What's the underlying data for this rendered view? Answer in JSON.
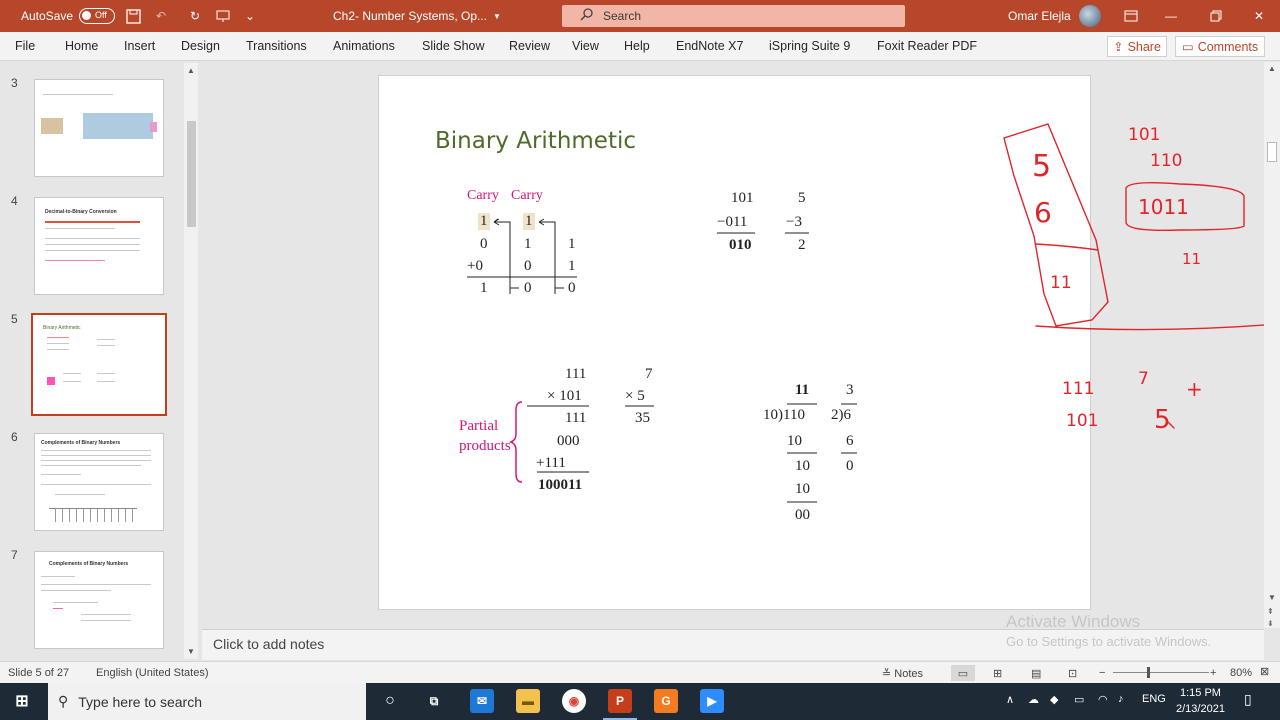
{
  "titlebar": {
    "autosave_label": "AutoSave",
    "autosave_state": "Off",
    "doc_title": "Ch2- Number Systems, Op...",
    "search_placeholder": "Search",
    "user_name": "Omar Elejla",
    "accent_color": "#b7472a"
  },
  "ribbon": {
    "tabs": [
      "File",
      "Home",
      "Insert",
      "Design",
      "Transitions",
      "Animations",
      "Slide Show",
      "Review",
      "View",
      "Help",
      "EndNote X7",
      "iSpring Suite 9",
      "Foxit Reader PDF"
    ],
    "share_label": "Share",
    "comments_label": "Comments"
  },
  "thumbnails": [
    {
      "number": "3",
      "title": ""
    },
    {
      "number": "4",
      "title": "Decimal-to-Binary Conversion"
    },
    {
      "number": "5",
      "title": "Binary Arithmetic"
    },
    {
      "number": "6",
      "title": "Complements of Binary Numbers"
    },
    {
      "number": "7",
      "title": "Complements of Binary Numbers"
    }
  ],
  "slide": {
    "title": "Binary Arithmetic",
    "addition": {
      "carry1": "Carry",
      "carry2": "Carry",
      "carry_vals": [
        "1",
        "1"
      ],
      "row1": [
        "0",
        "1",
        "1"
      ],
      "row2": [
        "+0",
        "0",
        "1"
      ],
      "result": [
        "1",
        "0",
        "0"
      ]
    },
    "subtraction": {
      "a": "101",
      "b": "−011",
      "result": "010",
      "da": "5",
      "db": "−3",
      "dresult": "2"
    },
    "multiplication": {
      "a": "111",
      "b": "× 101",
      "p1": "111",
      "p2": "000",
      "p3": "+111",
      "result": "100011",
      "da": "7",
      "db": "× 5",
      "dresult": "35",
      "partial_label_1": "Partial",
      "partial_label_2": "products"
    },
    "division": {
      "quotient": "11",
      "divisor_dividend": "10)110",
      "s1": "10",
      "r1": "10",
      "s2": "10",
      "r2": "00",
      "dquotient": "3",
      "ddivisor": "2)6",
      "ds1": "6",
      "dr1": "0"
    }
  },
  "annotations": [
    "5",
    "6",
    "11",
    "101",
    "110",
    "1011",
    "11",
    "111",
    "7",
    "+",
    "101",
    "5"
  ],
  "notes_placeholder": "Click to add notes",
  "watermark": {
    "line1": "Activate Windows",
    "line2": "Go to Settings to activate Windows."
  },
  "statusbar": {
    "slide_info": "Slide 5 of 27",
    "language": "English (United States)",
    "notes_label": "Notes",
    "zoom": "80%"
  },
  "taskbar": {
    "search_placeholder": "Type here to search",
    "lang": "ENG",
    "time": "1:15 PM",
    "date": "2/13/2021"
  }
}
